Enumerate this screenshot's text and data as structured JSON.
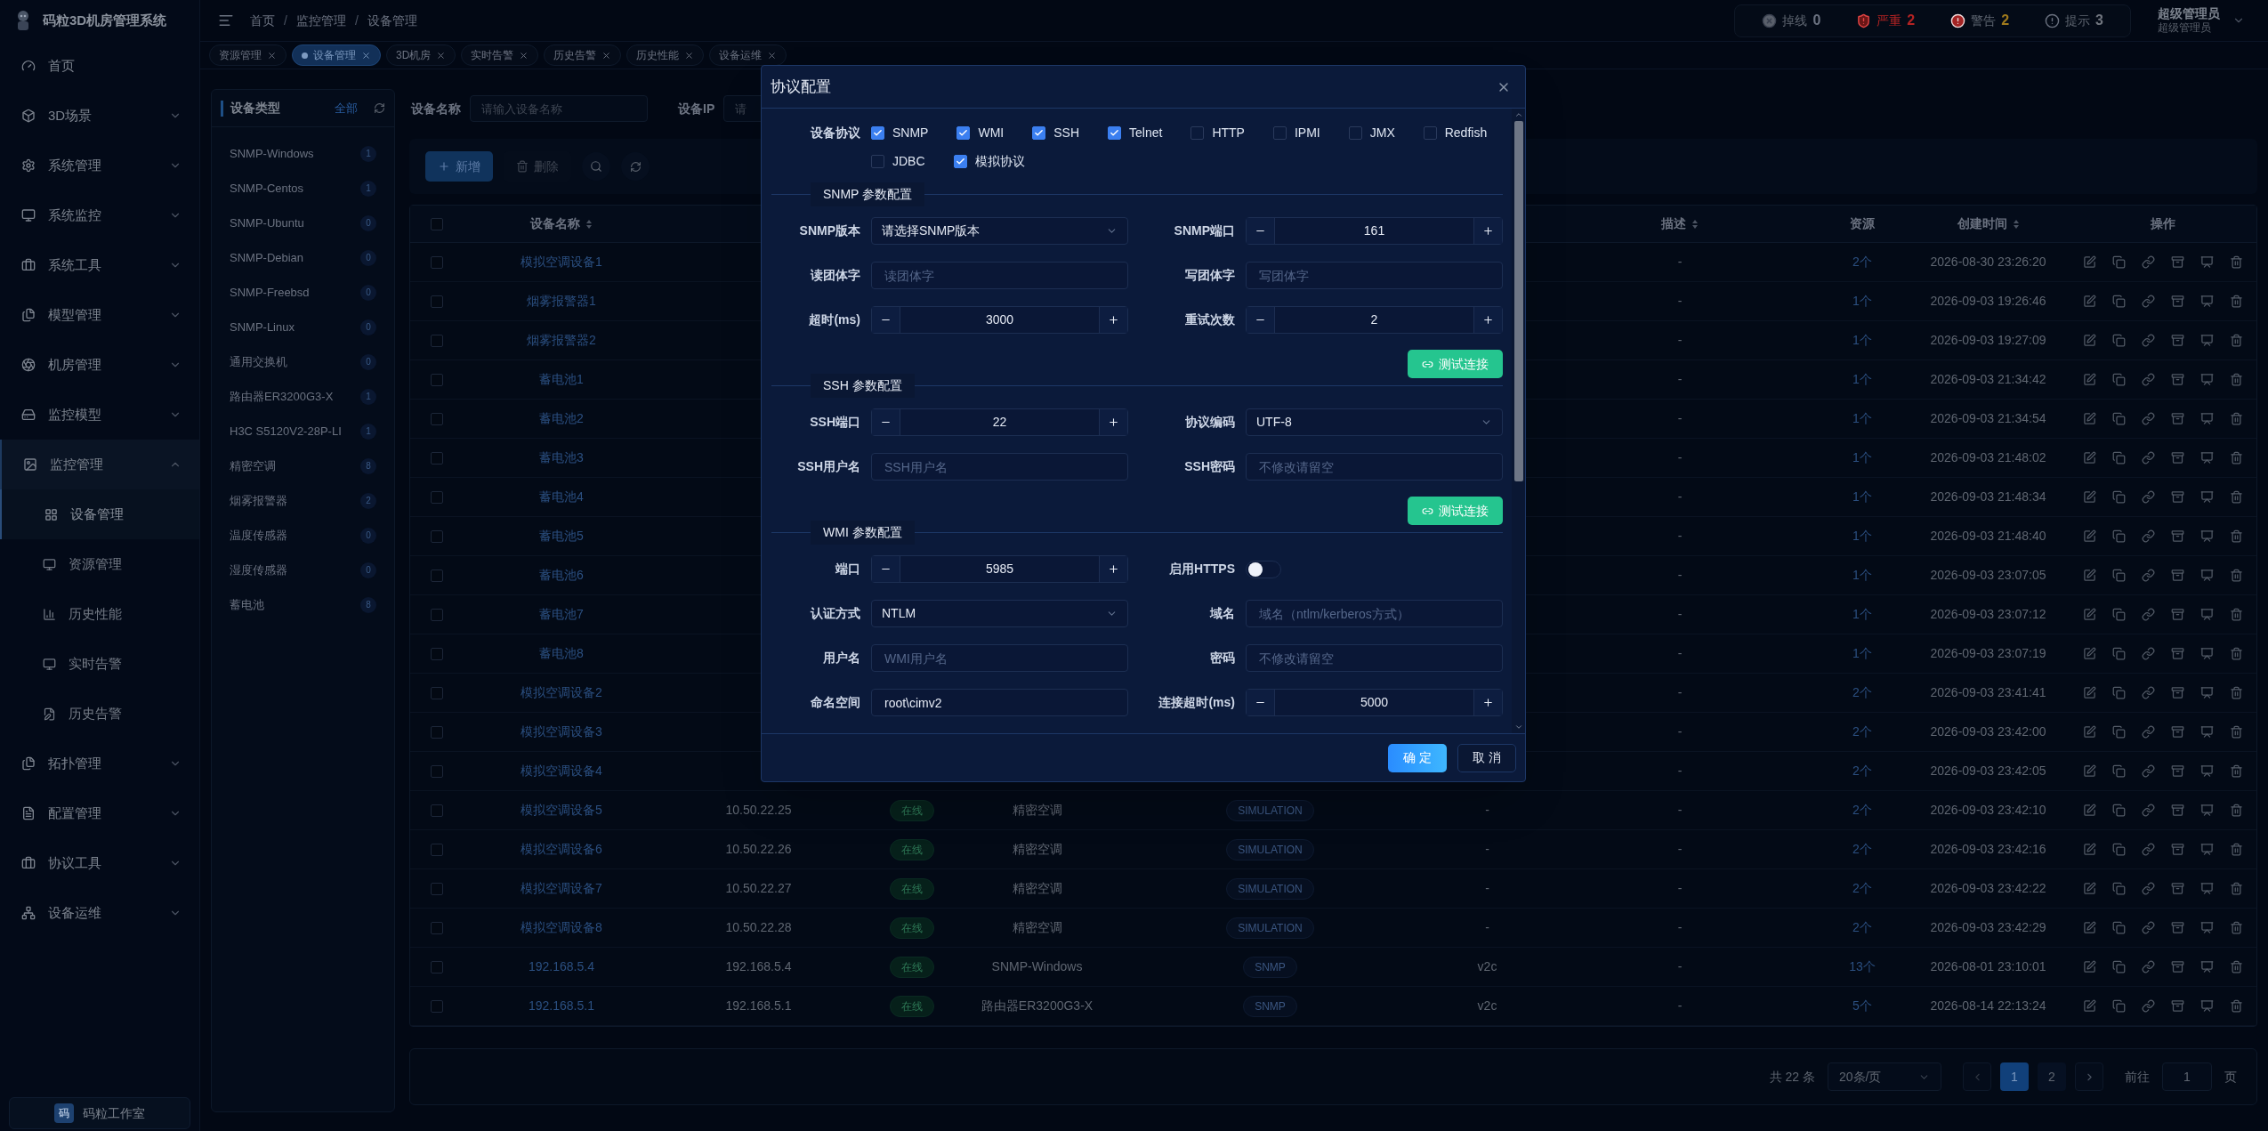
{
  "app": {
    "title": "码粒3D机房管理系统"
  },
  "sidebar": {
    "items": [
      {
        "label": "首页"
      },
      {
        "label": "3D场景",
        "expanded": false
      },
      {
        "label": "系统管理",
        "expanded": false
      },
      {
        "label": "系统监控",
        "expanded": false
      },
      {
        "label": "系统工具",
        "expanded": false
      },
      {
        "label": "模型管理",
        "expanded": false
      },
      {
        "label": "机房管理",
        "expanded": false
      },
      {
        "label": "监控模型",
        "expanded": false
      },
      {
        "label": "监控管理",
        "expanded": true,
        "children": [
          {
            "label": "设备管理",
            "selected": true
          },
          {
            "label": "资源管理",
            "selected": false
          },
          {
            "label": "历史性能",
            "selected": false
          },
          {
            "label": "实时告警",
            "selected": false
          },
          {
            "label": "历史告警",
            "selected": false
          }
        ]
      },
      {
        "label": "拓扑管理",
        "expanded": false
      },
      {
        "label": "配置管理",
        "expanded": false
      },
      {
        "label": "协议工具",
        "expanded": false
      },
      {
        "label": "设备运维",
        "expanded": false
      }
    ],
    "footer": {
      "badge": "码",
      "label": "码粒工作室"
    }
  },
  "breadcrumb": {
    "separator": "/",
    "items": [
      "首页",
      "监控管理",
      "设备管理"
    ]
  },
  "alerts": [
    {
      "kind": "offline",
      "label": "掉线",
      "count": "0",
      "color": "#6b7280"
    },
    {
      "kind": "critical",
      "label": "严重",
      "count": "2",
      "color": "#b42323"
    },
    {
      "kind": "warning",
      "label": "警告",
      "count": "2",
      "color": "#a07a1c"
    },
    {
      "kind": "info",
      "label": "提示",
      "count": "3",
      "color": "#70757e"
    }
  ],
  "user": {
    "name": "超级管理员",
    "role": "超级管理员"
  },
  "tabs": [
    {
      "label": "资源管理",
      "selected": false
    },
    {
      "label": "设备管理",
      "selected": true
    },
    {
      "label": "3D机房",
      "selected": false
    },
    {
      "label": "实时告警",
      "selected": false
    },
    {
      "label": "历史告警",
      "selected": false
    },
    {
      "label": "历史性能",
      "selected": false
    },
    {
      "label": "设备运维",
      "selected": false
    }
  ],
  "device_types": {
    "title": "设备类型",
    "all_link": "全部",
    "items": [
      {
        "name": "SNMP-Windows",
        "count": "1"
      },
      {
        "name": "SNMP-Centos",
        "count": "1"
      },
      {
        "name": "SNMP-Ubuntu",
        "count": "0"
      },
      {
        "name": "SNMP-Debian",
        "count": "0"
      },
      {
        "name": "SNMP-Freebsd",
        "count": "0"
      },
      {
        "name": "SNMP-Linux",
        "count": "0"
      },
      {
        "name": "通用交换机",
        "count": "0"
      },
      {
        "name": "路由器ER3200G3-X",
        "count": "1"
      },
      {
        "name": "H3C S5120V2-28P-LI",
        "count": "1"
      },
      {
        "name": "精密空调",
        "count": "8"
      },
      {
        "name": "烟雾报警器",
        "count": "2"
      },
      {
        "name": "温度传感器",
        "count": "0"
      },
      {
        "name": "湿度传感器",
        "count": "0"
      },
      {
        "name": "蓄电池",
        "count": "8"
      }
    ]
  },
  "filters": [
    {
      "label": "设备名称",
      "placeholder": "请输入设备名称"
    },
    {
      "label": "设备IP",
      "placeholder": "请"
    }
  ],
  "toolbar": {
    "add": "新增",
    "delete": "删除"
  },
  "table": {
    "all_checked": false,
    "columns": [
      {
        "label": "设备名称",
        "sortable": true
      },
      {
        "label": "描述",
        "sortable": true
      },
      {
        "label": "资源",
        "sortable": false
      },
      {
        "label": "创建时间",
        "sortable": true
      },
      {
        "label": "操作",
        "sortable": false
      }
    ],
    "rows": [
      {
        "checked": false,
        "name": "模拟空调设备1",
        "description": "-",
        "resources": "2个",
        "created": "2026-08-30 23:26:20"
      },
      {
        "checked": false,
        "name": "烟雾报警器1",
        "description": "-",
        "resources": "1个",
        "created": "2026-09-03 19:26:46"
      },
      {
        "checked": false,
        "name": "烟雾报警器2",
        "description": "-",
        "resources": "1个",
        "created": "2026-09-03 19:27:09"
      },
      {
        "checked": false,
        "name": "蓄电池1",
        "description": "-",
        "resources": "1个",
        "created": "2026-09-03 21:34:42"
      },
      {
        "checked": false,
        "name": "蓄电池2",
        "description": "-",
        "resources": "1个",
        "created": "2026-09-03 21:34:54"
      },
      {
        "checked": false,
        "name": "蓄电池3",
        "description": "-",
        "resources": "1个",
        "created": "2026-09-03 21:48:02"
      },
      {
        "checked": false,
        "name": "蓄电池4",
        "description": "-",
        "resources": "1个",
        "created": "2026-09-03 21:48:34"
      },
      {
        "checked": false,
        "name": "蓄电池5",
        "description": "-",
        "resources": "1个",
        "created": "2026-09-03 21:48:40"
      },
      {
        "checked": false,
        "name": "蓄电池6",
        "description": "-",
        "resources": "1个",
        "created": "2026-09-03 23:07:05"
      },
      {
        "checked": false,
        "name": "蓄电池7",
        "description": "-",
        "resources": "1个",
        "created": "2026-09-03 23:07:12"
      },
      {
        "checked": false,
        "name": "蓄电池8",
        "description": "-",
        "resources": "1个",
        "created": "2026-09-03 23:07:19"
      },
      {
        "checked": false,
        "name": "模拟空调设备2",
        "description": "-",
        "resources": "2个",
        "created": "2026-09-03 23:41:41"
      },
      {
        "checked": false,
        "name": "模拟空调设备3",
        "description": "-",
        "resources": "2个",
        "created": "2026-09-03 23:42:00"
      },
      {
        "checked": false,
        "name": "模拟空调设备4",
        "description": "-",
        "resources": "2个",
        "created": "2026-09-03 23:42:05"
      },
      {
        "checked": false,
        "name": "模拟空调设备5",
        "column_3": "10.50.22.25",
        "column_4": "在线",
        "column_5": "精密空调",
        "column_6": "SIMULATION",
        "column_7": "-",
        "description": "-",
        "resources": "2个",
        "created": "2026-09-03 23:42:10"
      },
      {
        "checked": false,
        "name": "模拟空调设备6",
        "column_3": "10.50.22.26",
        "column_4": "在线",
        "column_5": "精密空调",
        "column_6": "SIMULATION",
        "column_7": "-",
        "description": "-",
        "resources": "2个",
        "created": "2026-09-03 23:42:16"
      },
      {
        "checked": false,
        "name": "模拟空调设备7",
        "column_3": "10.50.22.27",
        "column_4": "在线",
        "column_5": "精密空调",
        "column_6": "SIMULATION",
        "column_7": "-",
        "description": "-",
        "resources": "2个",
        "created": "2026-09-03 23:42:22"
      },
      {
        "checked": false,
        "name": "模拟空调设备8",
        "column_3": "10.50.22.28",
        "column_4": "在线",
        "column_5": "精密空调",
        "column_6": "SIMULATION",
        "column_7": "-",
        "description": "-",
        "resources": "2个",
        "created": "2026-09-03 23:42:29"
      },
      {
        "checked": false,
        "name": "192.168.5.4",
        "column_3": "192.168.5.4",
        "column_4": "在线",
        "column_5": "SNMP-Windows",
        "column_6": "SNMP",
        "column_7": "v2c",
        "description": "-",
        "resources": "13个",
        "created": "2026-08-01 23:10:01"
      },
      {
        "checked": false,
        "name": "192.168.5.1",
        "column_3": "192.168.5.1",
        "column_4": "在线",
        "column_5": "路由器ER3200G3-X",
        "column_6": "SNMP",
        "column_7": "v2c",
        "description": "-",
        "resources": "5个",
        "created": "2026-08-14 22:13:24"
      }
    ]
  },
  "pagination": {
    "total": "共 22 条",
    "page_size": "20条/页",
    "pages": [
      {
        "label": "1",
        "selected": true
      },
      {
        "label": "2",
        "selected": false
      }
    ],
    "goto_label": "前往",
    "goto_value": "1",
    "goto_suffix": "页"
  },
  "modal": {
    "title": "协议配置",
    "protocols": {
      "label": "设备协议",
      "options": [
        {
          "label": "SNMP",
          "checked": true
        },
        {
          "label": "WMI",
          "checked": true
        },
        {
          "label": "SSH",
          "checked": true
        },
        {
          "label": "Telnet",
          "checked": true
        },
        {
          "label": "HTTP",
          "checked": false
        },
        {
          "label": "IPMI",
          "checked": false
        },
        {
          "label": "JMX",
          "checked": false
        },
        {
          "label": "Redfish",
          "checked": false
        },
        {
          "label": "JDBC",
          "checked": false
        },
        {
          "label": "模拟协议",
          "checked": true
        }
      ]
    },
    "sections": [
      {
        "title": "SNMP 参数配置",
        "button": "测试连接",
        "fields": [
          {
            "kind": "select",
            "label": "SNMP版本",
            "value": "请选择SNMP版本"
          },
          {
            "kind": "stepper",
            "label": "SNMP端口",
            "value": "161"
          },
          {
            "kind": "input",
            "label": "读团体字",
            "placeholder": "读团体字"
          },
          {
            "kind": "input",
            "label": "写团体字",
            "placeholder": "写团体字"
          },
          {
            "kind": "stepper",
            "label": "超时(ms)",
            "value": "3000"
          },
          {
            "kind": "stepper",
            "label": "重试次数",
            "value": "2"
          }
        ]
      },
      {
        "title": "SSH 参数配置",
        "button": "测试连接",
        "fields": [
          {
            "kind": "stepper",
            "label": "SSH端口",
            "value": "22"
          },
          {
            "kind": "select",
            "label": "协议编码",
            "value": "UTF-8"
          },
          {
            "kind": "input",
            "label": "SSH用户名",
            "placeholder": "SSH用户名"
          },
          {
            "kind": "input",
            "label": "SSH密码",
            "placeholder": "不修改请留空"
          }
        ]
      },
      {
        "title": "WMI 参数配置",
        "fields": [
          {
            "kind": "stepper",
            "label": "端口",
            "value": "5985"
          },
          {
            "kind": "switch",
            "label": "启用HTTPS",
            "on": false
          },
          {
            "kind": "select",
            "label": "认证方式",
            "value": "NTLM"
          },
          {
            "kind": "input",
            "label": "域名",
            "placeholder": "域名（ntlm/kerberos方式）"
          },
          {
            "kind": "input",
            "label": "用户名",
            "placeholder": "WMI用户名"
          },
          {
            "kind": "input",
            "label": "密码",
            "placeholder": "不修改请留空"
          },
          {
            "kind": "input",
            "label": "命名空间",
            "value": "root\\cimv2"
          },
          {
            "kind": "stepper",
            "label": "连接超时(ms)",
            "value": "5000"
          }
        ]
      }
    ],
    "confirm": "确 定",
    "cancel": "取 消"
  }
}
